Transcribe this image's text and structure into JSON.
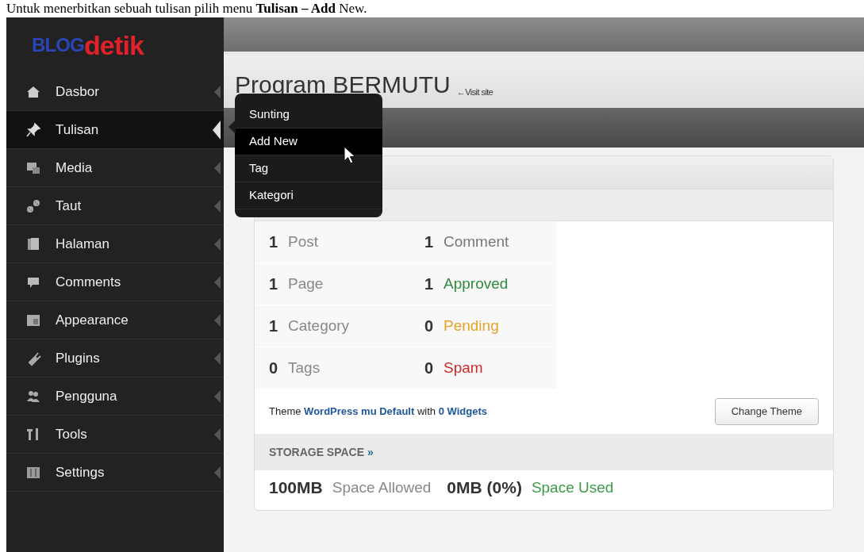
{
  "caption": "Untuk menerbitkan sebuah tulisan pilih menu **Tulisan – Add** New.",
  "logo": {
    "part1": "BLOG",
    "part2": "detik"
  },
  "sidebar": {
    "items": [
      {
        "label": "Dasbor",
        "selected": false
      },
      {
        "label": "Tulisan",
        "selected": true
      },
      {
        "label": "Media",
        "selected": false
      },
      {
        "label": "Taut",
        "selected": false
      },
      {
        "label": "Halaman",
        "selected": false
      },
      {
        "label": "Comments",
        "selected": false
      },
      {
        "label": "Appearance",
        "selected": false
      },
      {
        "label": "Plugins",
        "selected": false
      },
      {
        "label": "Pengguna",
        "selected": false
      },
      {
        "label": "Tools",
        "selected": false
      },
      {
        "label": "Settings",
        "selected": false
      }
    ]
  },
  "flyout": {
    "items": [
      {
        "label": "Sunting",
        "selected": false
      },
      {
        "label": "Add New",
        "selected": true
      },
      {
        "label": "Tag",
        "selected": false
      },
      {
        "label": "Kategori",
        "selected": false
      }
    ]
  },
  "header": {
    "title": "Program BERMUTU",
    "link": "←Visit site"
  },
  "glance": {
    "rows": [
      {
        "count": "1",
        "label": "Post",
        "count2": "1",
        "label2": "Comment",
        "color": "#777777"
      },
      {
        "count": "1",
        "label": "Page",
        "count2": "1",
        "label2": "Approved",
        "color": "#2e8b3e"
      },
      {
        "count": "1",
        "label": "Category",
        "count2": "0",
        "label2": "Pending",
        "color": "#e6a12a"
      },
      {
        "count": "0",
        "label": "Tags",
        "count2": "0",
        "label2": "Spam",
        "color": "#cc2a2a"
      }
    ]
  },
  "theme": {
    "prefix": "Theme",
    "theme_link": "WordPress mu Default",
    "middle": "with",
    "widgets_link": "0 Widgets",
    "button": "Change Theme"
  },
  "storage": {
    "title": "STORAGE SPACE",
    "link": "»",
    "allowed": "100MB",
    "allowed_label": "Space Allowed",
    "used": "0MB (0%)",
    "used_label": "Space Used"
  }
}
